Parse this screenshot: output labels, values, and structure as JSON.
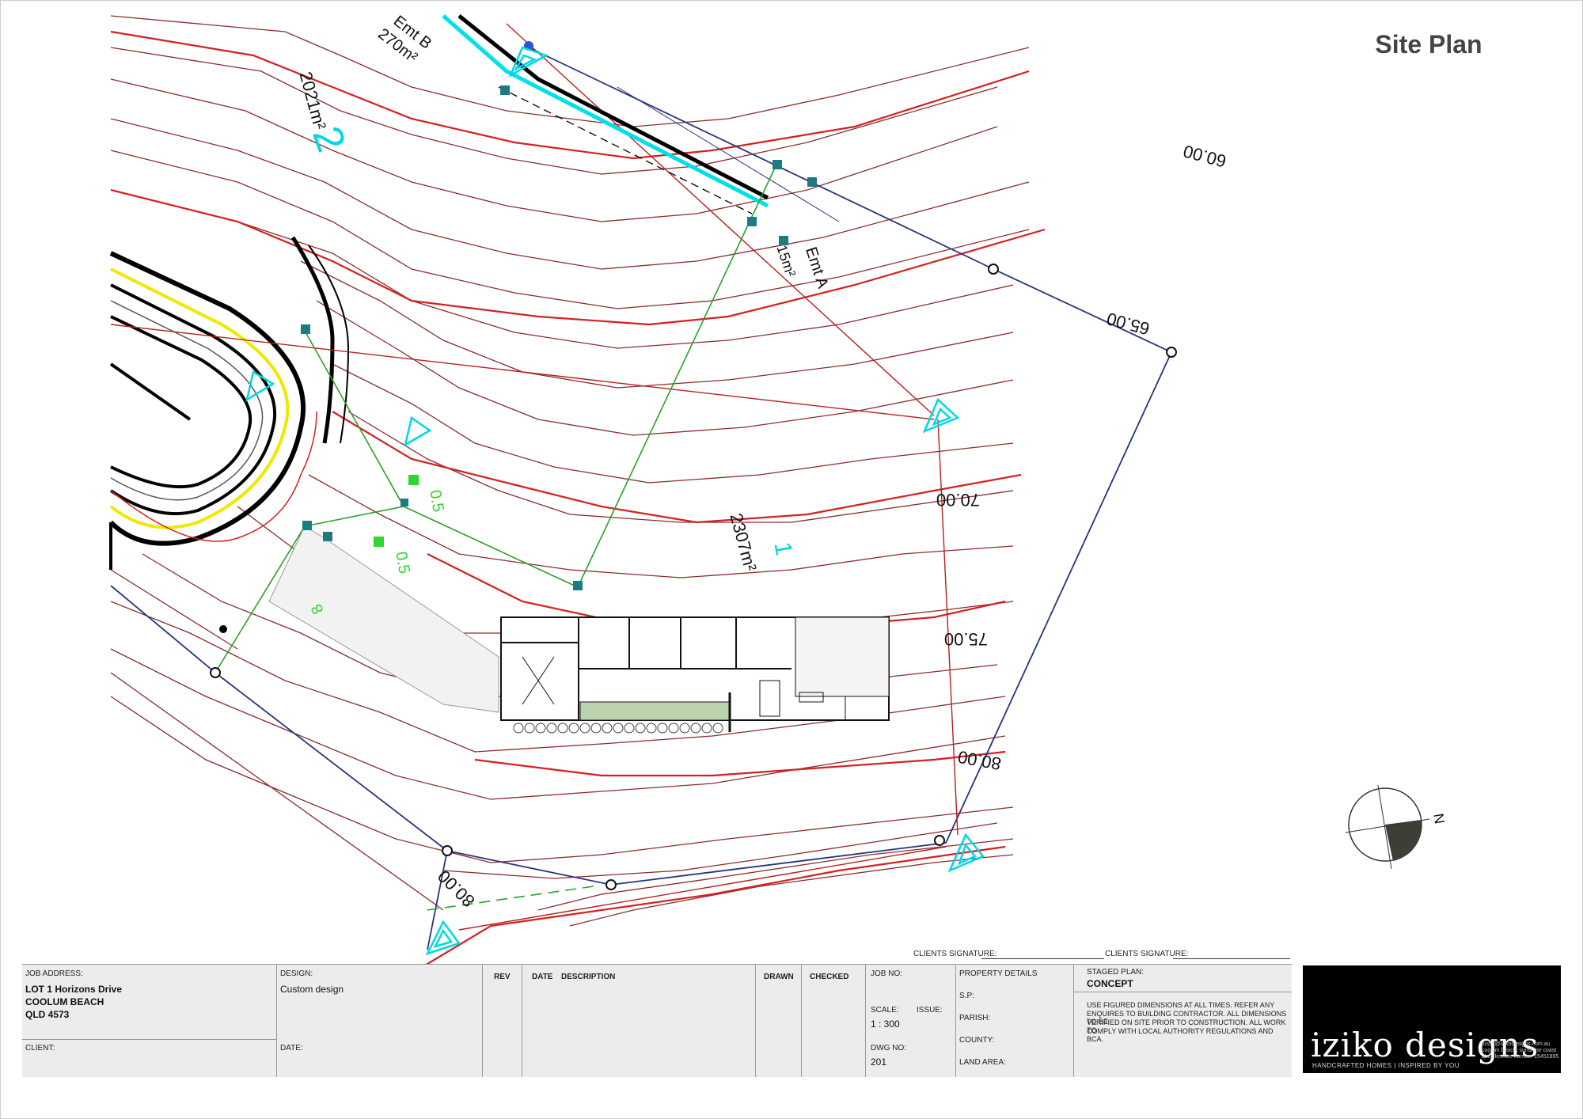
{
  "title": "Site Plan",
  "lots": [
    {
      "number": "2",
      "area": "2021m²"
    },
    {
      "number": "1",
      "area": "2307m²"
    }
  ],
  "easements": [
    {
      "name": "Emt B",
      "area": "270m²"
    },
    {
      "name": "Emt A",
      "area": "15m²"
    }
  ],
  "contour_labels": [
    "60.00",
    "65.00",
    "70.00",
    "75.00",
    "80.00",
    "80.00"
  ],
  "setback_labels": [
    "0.5",
    "0.5",
    "8"
  ],
  "colors": {
    "contour_major": "#d42020",
    "contour_minor": "#8a2c2c",
    "easement": "#00e0e8",
    "setback": "#2aa02a",
    "boundary": "#27347a",
    "kerb": "#f0e800"
  },
  "title_block": {
    "job_address_label": "JOB ADDRESS:",
    "job_address_lines": [
      "LOT 1 Horizons Drive",
      "COOLUM BEACH",
      "QLD 4573"
    ],
    "client_label": "CLIENT:",
    "design_label": "DESIGN:",
    "design_value": "Custom design",
    "date_label": "DATE:",
    "rev_label": "REV",
    "date_col_label": "DATE",
    "description_label": "DESCRIPTION",
    "drawn_label": "DRAWN",
    "checked_label": "CHECKED",
    "job_no_label": "JOB NO:",
    "scale_label": "SCALE:",
    "scale_value": "1 : 300",
    "issue_label": "ISSUE:",
    "dwg_no_label": "DWG NO:",
    "dwg_no_value": "201",
    "property_details_label": "PROPERTY DETAILS",
    "sp_label": "S.P:",
    "parish_label": "PARISH:",
    "county_label": "COUNTY:",
    "land_area_label": "LAND AREA:",
    "staged_plan_label": "STAGED PLAN:",
    "staged_plan_value": "CONCEPT",
    "notes_lines": [
      "USE FIGURED DIMENSIONS AT ALL TIMES. REFER ANY",
      "ENQUIRES TO BUILDING CONTRACTOR. ALL DIMENSIONS TO BE",
      "VERIFIED ON SITE PRIOR TO CONSTRUCTION. ALL WORK TO",
      "COMPLY WITH LOCAL AUTHORITY REGULATIONS AND BCA."
    ]
  },
  "signatures": {
    "label": "CLIENTS SIGNATURE:"
  },
  "logo": {
    "name": "iziko designs",
    "tagline": "HANDCRAFTED HOMES | INSPIRED BY YOU",
    "info_lines": [
      "justin@izikodesigns.com.au",
      "coolum beach, sunshine coast",
      "qbcc licence number 15451895"
    ]
  },
  "north_label": "N"
}
